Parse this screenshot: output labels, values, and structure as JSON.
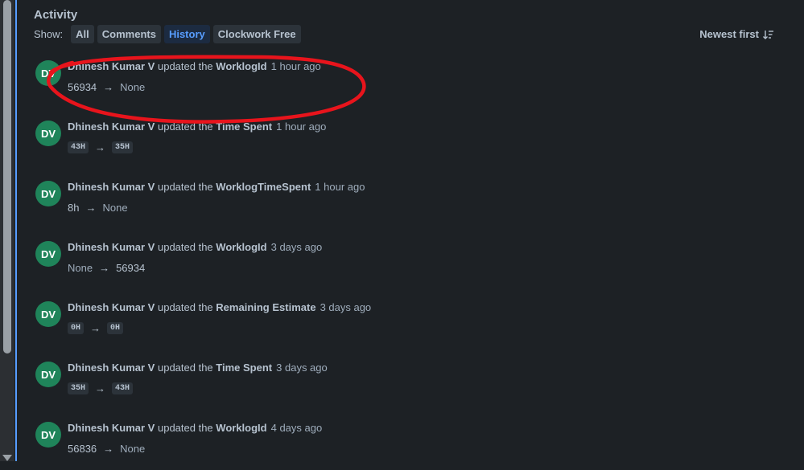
{
  "activity": {
    "title": "Activity",
    "show_label": "Show:",
    "filters": [
      {
        "label": "All",
        "active": false
      },
      {
        "label": "Comments",
        "active": false
      },
      {
        "label": "History",
        "active": true
      },
      {
        "label": "Clockwork Free",
        "active": false
      }
    ],
    "sort_label": "Newest first"
  },
  "entries": [
    {
      "initials": "DV",
      "author": "Dhinesh Kumar V",
      "verb": "updated the",
      "field": "WorklogId",
      "time": "1 hour ago",
      "from": "56934",
      "arrow": "→",
      "to": "None",
      "style": "text"
    },
    {
      "initials": "DV",
      "author": "Dhinesh Kumar V",
      "verb": "updated the",
      "field": "Time Spent",
      "time": "1 hour ago",
      "from": "43H",
      "arrow": "→",
      "to": "35H",
      "style": "chip"
    },
    {
      "initials": "DV",
      "author": "Dhinesh Kumar V",
      "verb": "updated the",
      "field": "WorklogTimeSpent",
      "time": "1 hour ago",
      "from": "8h",
      "arrow": "→",
      "to": "None",
      "style": "text"
    },
    {
      "initials": "DV",
      "author": "Dhinesh Kumar V",
      "verb": "updated the",
      "field": "WorklogId",
      "time": "3 days ago",
      "from": "None",
      "arrow": "→",
      "to": "56934",
      "style": "text"
    },
    {
      "initials": "DV",
      "author": "Dhinesh Kumar V",
      "verb": "updated the",
      "field": "Remaining Estimate",
      "time": "3 days ago",
      "from": "0H",
      "arrow": "→",
      "to": "0H",
      "style": "chip"
    },
    {
      "initials": "DV",
      "author": "Dhinesh Kumar V",
      "verb": "updated the",
      "field": "Time Spent",
      "time": "3 days ago",
      "from": "35H",
      "arrow": "→",
      "to": "43H",
      "style": "chip"
    },
    {
      "initials": "DV",
      "author": "Dhinesh Kumar V",
      "verb": "updated the",
      "field": "WorklogId",
      "time": "4 days ago",
      "from": "56836",
      "arrow": "→",
      "to": "None",
      "style": "text"
    }
  ],
  "colors": {
    "background": "#1d2125",
    "accent": "#579dff",
    "avatar": "#1f845a",
    "annotation": "#e8141c"
  },
  "icons": {
    "sort": "sort-descending-icon",
    "scroll": "scroll-down-arrow-icon"
  }
}
